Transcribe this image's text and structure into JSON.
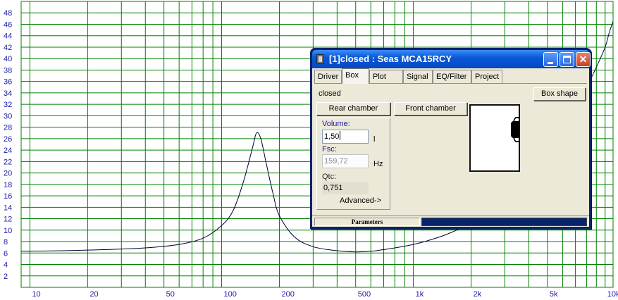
{
  "chart_data": {
    "type": "line",
    "title": "",
    "xlabel": "",
    "ylabel": "",
    "x_scale": "log",
    "xlim": [
      9,
      11000
    ],
    "ylim": [
      0,
      50
    ],
    "y_ticks": [
      2,
      4,
      6,
      8,
      10,
      12,
      14,
      16,
      18,
      20,
      22,
      24,
      26,
      28,
      30,
      32,
      34,
      36,
      38,
      40,
      42,
      44,
      46,
      48
    ],
    "x_tick_labels": [
      {
        "value": 10,
        "label": "10"
      },
      {
        "value": 20,
        "label": "20"
      },
      {
        "value": 50,
        "label": "50"
      },
      {
        "value": 100,
        "label": "100"
      },
      {
        "value": 200,
        "label": "200"
      },
      {
        "value": 500,
        "label": "500"
      },
      {
        "value": 1000,
        "label": "1k"
      },
      {
        "value": 2000,
        "label": "2k"
      },
      {
        "value": 5000,
        "label": "5k"
      },
      {
        "value": 10000,
        "label": "10k"
      }
    ],
    "grid": true,
    "grid_color": "#008000",
    "line_color": "#000033",
    "series": [
      {
        "name": "",
        "x": [
          9,
          15,
          25,
          40,
          60,
          80,
          100,
          115,
          130,
          145,
          152,
          160,
          170,
          185,
          200,
          240,
          300,
          400,
          500,
          600,
          700,
          800,
          1000,
          1200,
          1500,
          2000,
          2500,
          3000,
          4000,
          5000,
          6000,
          7000,
          8000,
          9000,
          10000,
          10500,
          11000
        ],
        "y": [
          6.3,
          6.4,
          6.6,
          6.9,
          7.5,
          8.6,
          10.8,
          13.5,
          18.5,
          24.5,
          27,
          26,
          22,
          16.5,
          12.5,
          8.8,
          7.1,
          6.4,
          6.2,
          6.3,
          6.6,
          6.9,
          7.5,
          8.2,
          9.3,
          11.2,
          13.2,
          15.2,
          19.5,
          23.8,
          28,
          31.5,
          35,
          38.5,
          42,
          44.5,
          46.5
        ]
      }
    ]
  },
  "dialog": {
    "title": "[1]closed : Seas MCA15RCY",
    "tabs": [
      "Driver",
      "Box",
      "Plot",
      "Signal",
      "EQ/Filter",
      "Project"
    ],
    "active_tab": "Box",
    "box_type": "closed",
    "box_shape_button": "Box shape",
    "rear_chamber_button": "Rear chamber",
    "front_chamber_button": "Front chamber",
    "volume_label": "Volume:",
    "volume_value": "1,50",
    "volume_unit": "l",
    "fsc_label": "Fsc:",
    "fsc_value": "159,72",
    "fsc_unit": "Hz",
    "qtc_label": "Qtc:",
    "qtc_value": "0,751",
    "advanced_button": "Advanced->",
    "status_caption": "Parameters"
  }
}
